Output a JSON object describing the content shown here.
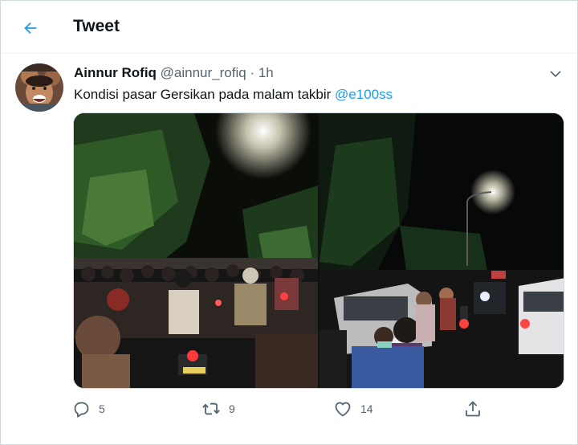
{
  "header": {
    "title": "Tweet",
    "back_icon": "arrow-left-icon"
  },
  "tweet": {
    "author_name": "Ainnur Rofiq",
    "author_handle": "@ainnur_rofiq",
    "separator": "·",
    "time": "1h",
    "text": "Kondisi pasar Gersikan pada malam takbir ",
    "mention": "@e100ss",
    "media": [
      {
        "kind": "photo"
      },
      {
        "kind": "photo"
      }
    ],
    "actions": {
      "reply_count": "5",
      "retweet_count": "9",
      "like_count": "14",
      "share_count": ""
    }
  },
  "colors": {
    "accent": "#1d9bf0",
    "icon": "#536471",
    "text": "#0f1419"
  }
}
